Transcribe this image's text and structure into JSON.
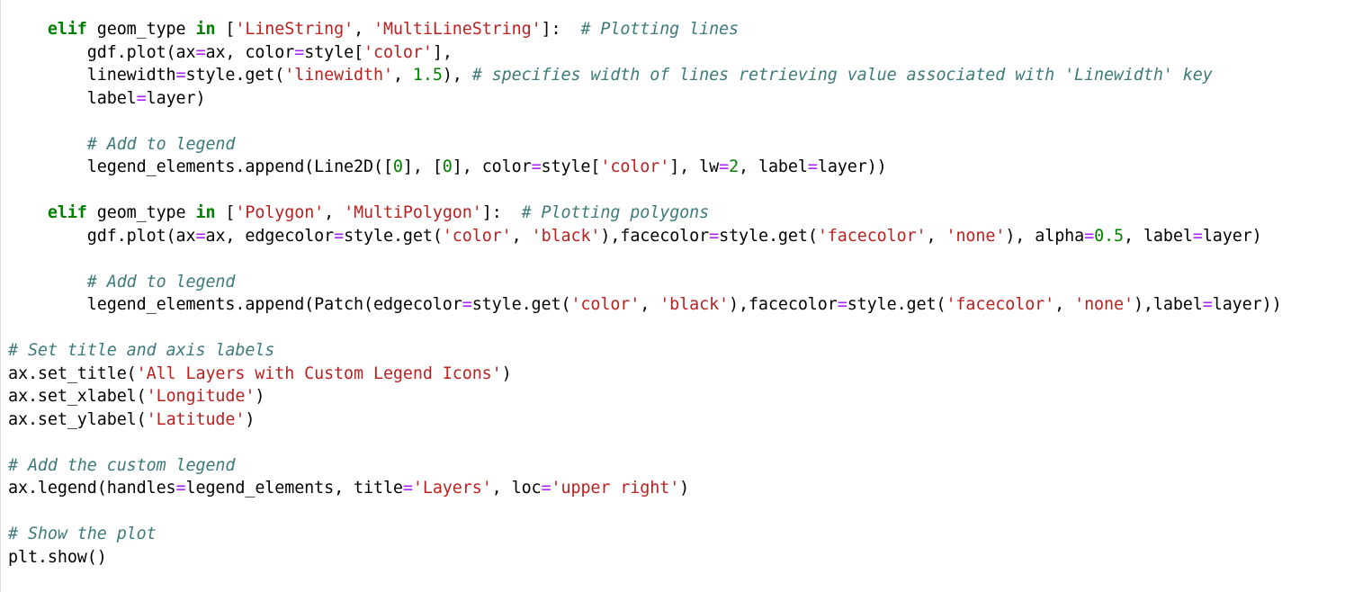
{
  "editor": {
    "lines": [
      [
        {
          "t": "    ",
          "k": "plain"
        },
        {
          "t": "elif",
          "k": "kw"
        },
        {
          "t": " geom_type ",
          "k": "plain"
        },
        {
          "t": "in",
          "k": "kw"
        },
        {
          "t": " [",
          "k": "plain"
        },
        {
          "t": "'LineString'",
          "k": "str"
        },
        {
          "t": ", ",
          "k": "plain"
        },
        {
          "t": "'MultiLineString'",
          "k": "str"
        },
        {
          "t": "]:  ",
          "k": "plain"
        },
        {
          "t": "# Plotting lines",
          "k": "com"
        }
      ],
      [
        {
          "t": "        gdf.plot(ax",
          "k": "plain"
        },
        {
          "t": "=",
          "k": "op"
        },
        {
          "t": "ax, color",
          "k": "plain"
        },
        {
          "t": "=",
          "k": "op"
        },
        {
          "t": "style[",
          "k": "plain"
        },
        {
          "t": "'color'",
          "k": "str"
        },
        {
          "t": "],",
          "k": "plain"
        }
      ],
      [
        {
          "t": "        linewidth",
          "k": "plain"
        },
        {
          "t": "=",
          "k": "op"
        },
        {
          "t": "style.get(",
          "k": "plain"
        },
        {
          "t": "'linewidth'",
          "k": "str"
        },
        {
          "t": ", ",
          "k": "plain"
        },
        {
          "t": "1.5",
          "k": "num"
        },
        {
          "t": "), ",
          "k": "plain"
        },
        {
          "t": "# specifies width of lines retrieving value associated with 'Linewidth' key",
          "k": "com"
        }
      ],
      [
        {
          "t": "        label",
          "k": "plain"
        },
        {
          "t": "=",
          "k": "op"
        },
        {
          "t": "layer)",
          "k": "plain"
        }
      ],
      [],
      [
        {
          "t": "        ",
          "k": "plain"
        },
        {
          "t": "# Add to legend",
          "k": "com"
        }
      ],
      [
        {
          "t": "        legend_elements.append(Line2D([",
          "k": "plain"
        },
        {
          "t": "0",
          "k": "num"
        },
        {
          "t": "], [",
          "k": "plain"
        },
        {
          "t": "0",
          "k": "num"
        },
        {
          "t": "], color",
          "k": "plain"
        },
        {
          "t": "=",
          "k": "op"
        },
        {
          "t": "style[",
          "k": "plain"
        },
        {
          "t": "'color'",
          "k": "str"
        },
        {
          "t": "], lw",
          "k": "plain"
        },
        {
          "t": "=",
          "k": "op"
        },
        {
          "t": "2",
          "k": "num"
        },
        {
          "t": ", label",
          "k": "plain"
        },
        {
          "t": "=",
          "k": "op"
        },
        {
          "t": "layer))",
          "k": "plain"
        }
      ],
      [],
      [
        {
          "t": "    ",
          "k": "plain"
        },
        {
          "t": "elif",
          "k": "kw"
        },
        {
          "t": " geom_type ",
          "k": "plain"
        },
        {
          "t": "in",
          "k": "kw"
        },
        {
          "t": " [",
          "k": "plain"
        },
        {
          "t": "'Polygon'",
          "k": "str"
        },
        {
          "t": ", ",
          "k": "plain"
        },
        {
          "t": "'MultiPolygon'",
          "k": "str"
        },
        {
          "t": "]:  ",
          "k": "plain"
        },
        {
          "t": "# Plotting polygons",
          "k": "com"
        }
      ],
      [
        {
          "t": "        gdf.plot(ax",
          "k": "plain"
        },
        {
          "t": "=",
          "k": "op"
        },
        {
          "t": "ax, edgecolor",
          "k": "plain"
        },
        {
          "t": "=",
          "k": "op"
        },
        {
          "t": "style.get(",
          "k": "plain"
        },
        {
          "t": "'color'",
          "k": "str"
        },
        {
          "t": ", ",
          "k": "plain"
        },
        {
          "t": "'black'",
          "k": "str"
        },
        {
          "t": "),facecolor",
          "k": "plain"
        },
        {
          "t": "=",
          "k": "op"
        },
        {
          "t": "style.get(",
          "k": "plain"
        },
        {
          "t": "'facecolor'",
          "k": "str"
        },
        {
          "t": ", ",
          "k": "plain"
        },
        {
          "t": "'none'",
          "k": "str"
        },
        {
          "t": "), alpha",
          "k": "plain"
        },
        {
          "t": "=",
          "k": "op"
        },
        {
          "t": "0.5",
          "k": "num"
        },
        {
          "t": ", label",
          "k": "plain"
        },
        {
          "t": "=",
          "k": "op"
        },
        {
          "t": "layer)",
          "k": "plain"
        }
      ],
      [],
      [
        {
          "t": "        ",
          "k": "plain"
        },
        {
          "t": "# Add to legend",
          "k": "com"
        }
      ],
      [
        {
          "t": "        legend_elements.append(Patch(edgecolor",
          "k": "plain"
        },
        {
          "t": "=",
          "k": "op"
        },
        {
          "t": "style.get(",
          "k": "plain"
        },
        {
          "t": "'color'",
          "k": "str"
        },
        {
          "t": ", ",
          "k": "plain"
        },
        {
          "t": "'black'",
          "k": "str"
        },
        {
          "t": "),facecolor",
          "k": "plain"
        },
        {
          "t": "=",
          "k": "op"
        },
        {
          "t": "style.get(",
          "k": "plain"
        },
        {
          "t": "'facecolor'",
          "k": "str"
        },
        {
          "t": ", ",
          "k": "plain"
        },
        {
          "t": "'none'",
          "k": "str"
        },
        {
          "t": "),label",
          "k": "plain"
        },
        {
          "t": "=",
          "k": "op"
        },
        {
          "t": "layer))",
          "k": "plain"
        }
      ],
      [],
      [
        {
          "t": "# Set title and axis labels",
          "k": "com"
        }
      ],
      [
        {
          "t": "ax.set_title(",
          "k": "plain"
        },
        {
          "t": "'All Layers with Custom Legend Icons'",
          "k": "str"
        },
        {
          "t": ")",
          "k": "plain"
        }
      ],
      [
        {
          "t": "ax.set_xlabel(",
          "k": "plain"
        },
        {
          "t": "'Longitude'",
          "k": "str"
        },
        {
          "t": ")",
          "k": "plain"
        }
      ],
      [
        {
          "t": "ax.set_ylabel(",
          "k": "plain"
        },
        {
          "t": "'Latitude'",
          "k": "str"
        },
        {
          "t": ")",
          "k": "plain"
        }
      ],
      [],
      [
        {
          "t": "# Add the custom legend",
          "k": "com"
        }
      ],
      [
        {
          "t": "ax.legend(handles",
          "k": "plain"
        },
        {
          "t": "=",
          "k": "op"
        },
        {
          "t": "legend_elements, title",
          "k": "plain"
        },
        {
          "t": "=",
          "k": "op"
        },
        {
          "t": "'Layers'",
          "k": "str"
        },
        {
          "t": ", loc",
          "k": "plain"
        },
        {
          "t": "=",
          "k": "op"
        },
        {
          "t": "'upper right'",
          "k": "str"
        },
        {
          "t": ")",
          "k": "plain"
        }
      ],
      [],
      [
        {
          "t": "# Show the plot",
          "k": "com"
        }
      ],
      [
        {
          "t": "plt.show()",
          "k": "plain"
        }
      ]
    ]
  },
  "colors": {
    "keyword": "#008000",
    "string": "#ba2121",
    "comment": "#3d7b7b",
    "operator": "#aa22ff",
    "number": "#008000",
    "text": "#000000",
    "background": "#ffffff"
  }
}
